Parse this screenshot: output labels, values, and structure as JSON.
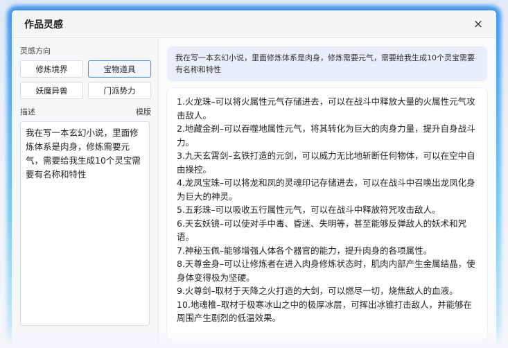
{
  "dialog": {
    "title": "作品灵感",
    "close_icon": "×"
  },
  "left": {
    "direction_label": "灵感方向",
    "options": [
      {
        "label": "修炼境界",
        "selected": false
      },
      {
        "label": "宝物道具",
        "selected": true
      },
      {
        "label": "妖魔异兽",
        "selected": false
      },
      {
        "label": "门派势力",
        "selected": false
      }
    ],
    "description_label": "描述",
    "template_label": "模版",
    "description_value": "我在写一本玄幻小说，里面修炼体系是肉身，修炼需要元气，需要给我生成10个灵宝需要有名称和特性"
  },
  "right": {
    "prompt": "我在写一本玄幻小说，里面修炼体系是肉身，修炼需要元气，需要给我生成10个灵宝需要有名称和特性",
    "answers": [
      "1.火龙珠–可以将火属性元气存储进去，可以在战斗中释放大量的火属性元气攻击敌人。",
      "2.地藏金刹–可以吞噬地属性元气，将其转化为巨大的肉身力量，提升自身战斗力。",
      "3.九天玄霄剑–玄铁打造的元剑，可以威力无比地斩断任何物体，可以在空中自由操控。",
      "4.龙凤宝珠–可以将龙和凤的灵魂印记存储进去，可以在战斗中召唤出龙凤化身为巨大的神灵。",
      "5.五彩珠–可以吸收五行属性元气，可以在战斗中释放符咒攻击敌人。",
      "6.天玄妖镜–可以使对手中毒、昏迷、失明等，甚至能够反弹敌人的妖术和咒语。",
      "7.神秘玉佩–能够增强人体各个器官的能力，提升肉身的各项属性。",
      "8.天尊金身–可以让修炼者在进入肉身修炼状态时，肌肉内部产生金属结晶，使身体变得极为坚硬。",
      "9.火尊剑–取材于天降之火打造的大剑，可以燃尽一切，烧焦敌人的血液。",
      "10.地魂椎–取材于极寒冰山之中的极厚冰层，可挥出冰锥打击敌人，并能够在周围产生剧烈的低温效果。"
    ]
  }
}
